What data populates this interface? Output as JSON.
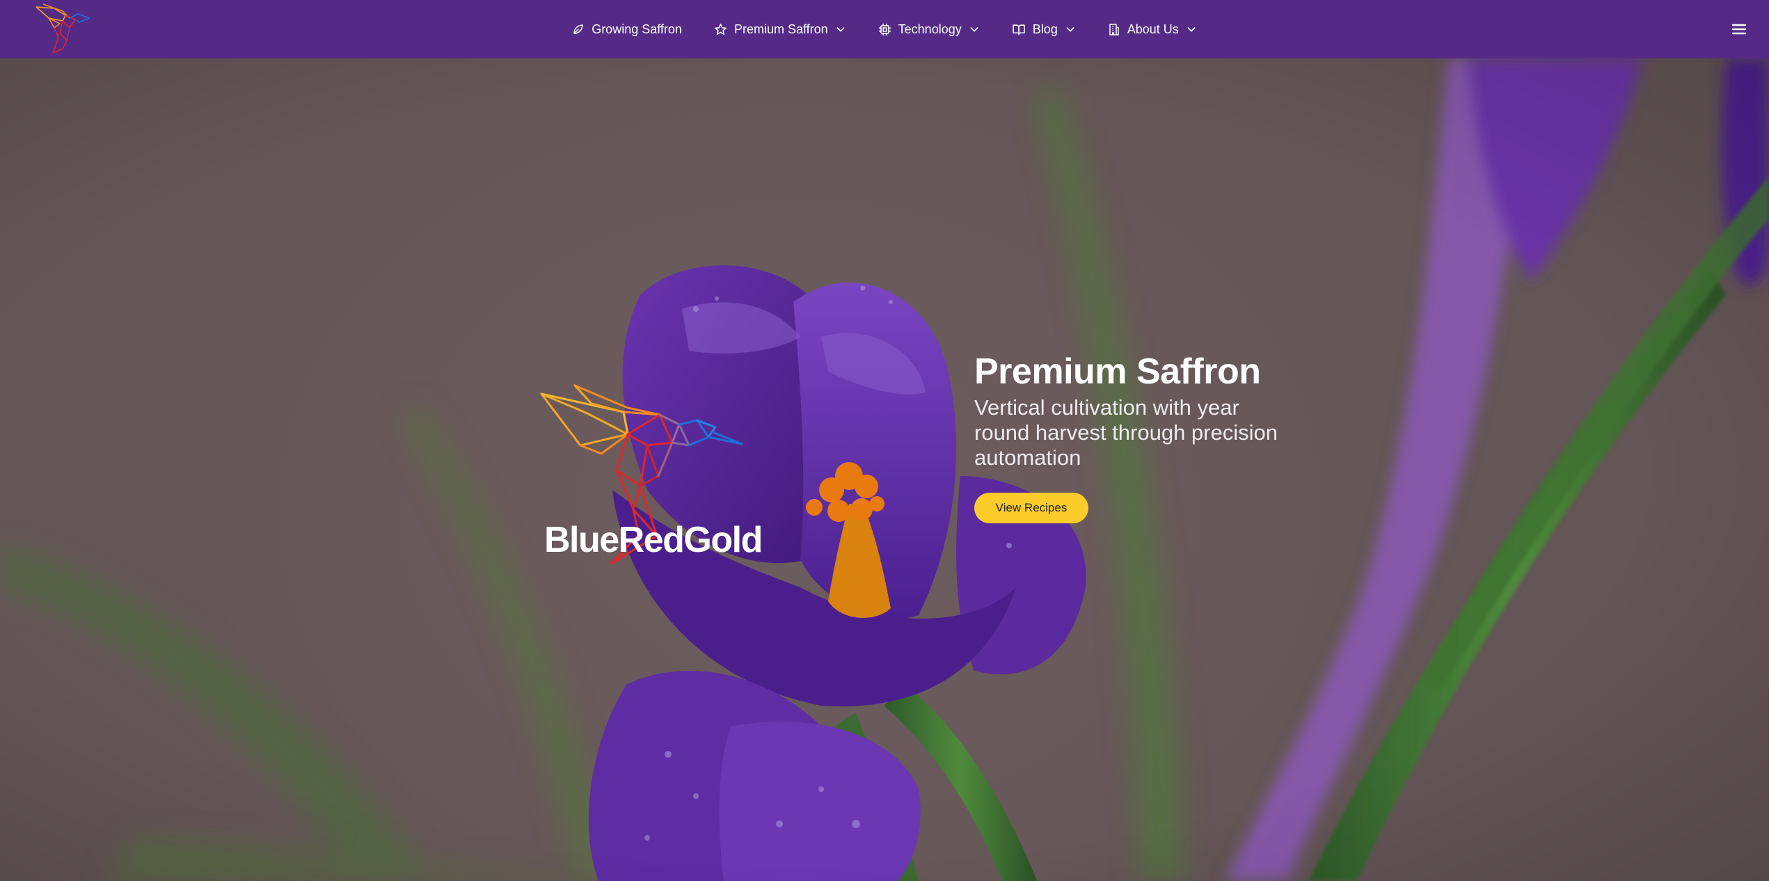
{
  "nav": {
    "items": [
      {
        "label": "Growing Saffron",
        "icon": "leaf-icon",
        "has_dropdown": false
      },
      {
        "label": "Premium Saffron",
        "icon": "star-icon",
        "has_dropdown": true
      },
      {
        "label": "Technology",
        "icon": "cpu-chip-icon",
        "has_dropdown": true
      },
      {
        "label": "Blog",
        "icon": "book-open-icon",
        "has_dropdown": true
      },
      {
        "label": "About Us",
        "icon": "building-icon",
        "has_dropdown": true
      }
    ],
    "menu_icon": "hamburger-menu-icon"
  },
  "hero": {
    "brand_name": "BlueRedGold",
    "title": "Premium Saffron",
    "subtitle": "Vertical cultivation with year round harvest through precision automation",
    "cta_label": "View Recipes"
  },
  "colors": {
    "nav_background": "#542a86",
    "cta_background": "#fbcc2a",
    "logo_gold": "#f5a623",
    "logo_red": "#e0262b",
    "logo_blue": "#1e6fd9",
    "flower_purple": "#5b2a9a",
    "stigma_orange": "#e97a10"
  }
}
